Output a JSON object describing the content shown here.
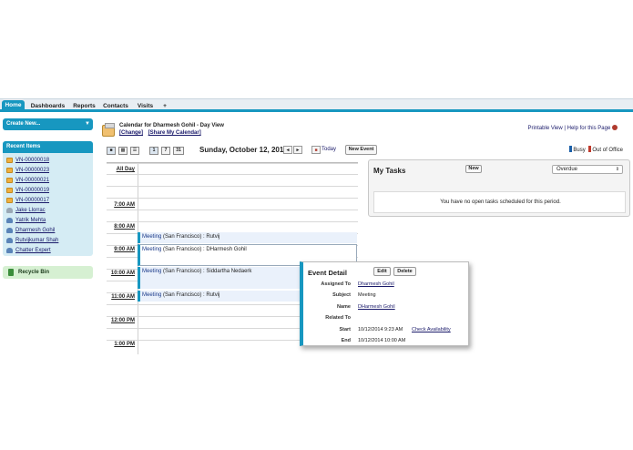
{
  "tabs": [
    {
      "label": "Home",
      "active": true
    },
    {
      "label": "Dashboards",
      "active": false
    },
    {
      "label": "Reports",
      "active": false
    },
    {
      "label": "Contacts",
      "active": false
    },
    {
      "label": "Visits",
      "active": false
    },
    {
      "label": "+",
      "active": false
    }
  ],
  "sidebar": {
    "create_new": "Create New...",
    "recent_title": "Recent Items",
    "recent_items": [
      {
        "label": "VN-00000018",
        "icon": "visit-icon"
      },
      {
        "label": "VN-00000023",
        "icon": "visit-icon"
      },
      {
        "label": "VN-00000021",
        "icon": "visit-icon"
      },
      {
        "label": "VN-00000019",
        "icon": "visit-icon"
      },
      {
        "label": "VN-00000017",
        "icon": "visit-icon"
      },
      {
        "label": "Jake Llorrac",
        "icon": "person-icon"
      },
      {
        "label": "Yatrik Mehta",
        "icon": "person-icon"
      },
      {
        "label": "Dharmesh Gohil",
        "icon": "person-icon"
      },
      {
        "label": "Rutvijkumar Shah",
        "icon": "person-icon"
      },
      {
        "label": "Chatter Expert",
        "icon": "person-icon"
      }
    ],
    "recycle_bin": "Recycle Bin"
  },
  "header": {
    "title": "Calendar for Dharmesh Gohil - Day View",
    "change": "[Change]",
    "share": "[Share My Calendar]",
    "printable": "Printable View",
    "separator": "|",
    "help": "Help for this Page"
  },
  "toolbar": {
    "date": "Sunday, October 12, 2014",
    "prev": "◄",
    "next": "►",
    "today": "Today",
    "new_event": "New Event",
    "day_view": "1",
    "week_view": "7",
    "month_view": "31",
    "legend_busy": "Busy",
    "legend_out": "Out of Office",
    "colors": {
      "busy": "#1a5fa8",
      "out_of_office": "#c0392b"
    }
  },
  "day": {
    "all_day": "All Day",
    "hours": [
      "7:00 AM",
      "8:00 AM",
      "9:00 AM",
      "10:00 AM",
      "11:00 AM",
      "12:00 PM",
      "1:00 PM"
    ],
    "events": [
      {
        "name": "Meeting",
        "rest": " (San Francisco) : Rutvij"
      },
      {
        "name": "Meeting",
        "rest": " (San Francisco) : DHarmesh Gohil"
      },
      {
        "name": "Meeting",
        "rest": " (San Francisco) : Siddartha Nedaerk"
      },
      {
        "name": "Meeting",
        "rest": " (San Francisco) : Rutvij"
      }
    ]
  },
  "tasks": {
    "title": "My Tasks",
    "new": "New",
    "filter": "Overdue",
    "empty_message": "You have no open tasks scheduled for this period."
  },
  "event_detail": {
    "title": "Event Detail",
    "edit": "Edit",
    "delete": "Delete",
    "rows": [
      {
        "label": "Assigned To",
        "value": "Dharmesh Gohil"
      },
      {
        "label": "Subject",
        "value": "Meeting"
      },
      {
        "label": "Name",
        "value": "DHarmesh Gohil"
      },
      {
        "label": "Related To",
        "value": ""
      },
      {
        "label": "Start",
        "value": "10/12/2014 9:23 AM"
      },
      {
        "label": "End",
        "value": "10/12/2014 10:00 AM"
      }
    ],
    "check_availability": "Check Availability"
  },
  "accent_color": "#1797c0"
}
